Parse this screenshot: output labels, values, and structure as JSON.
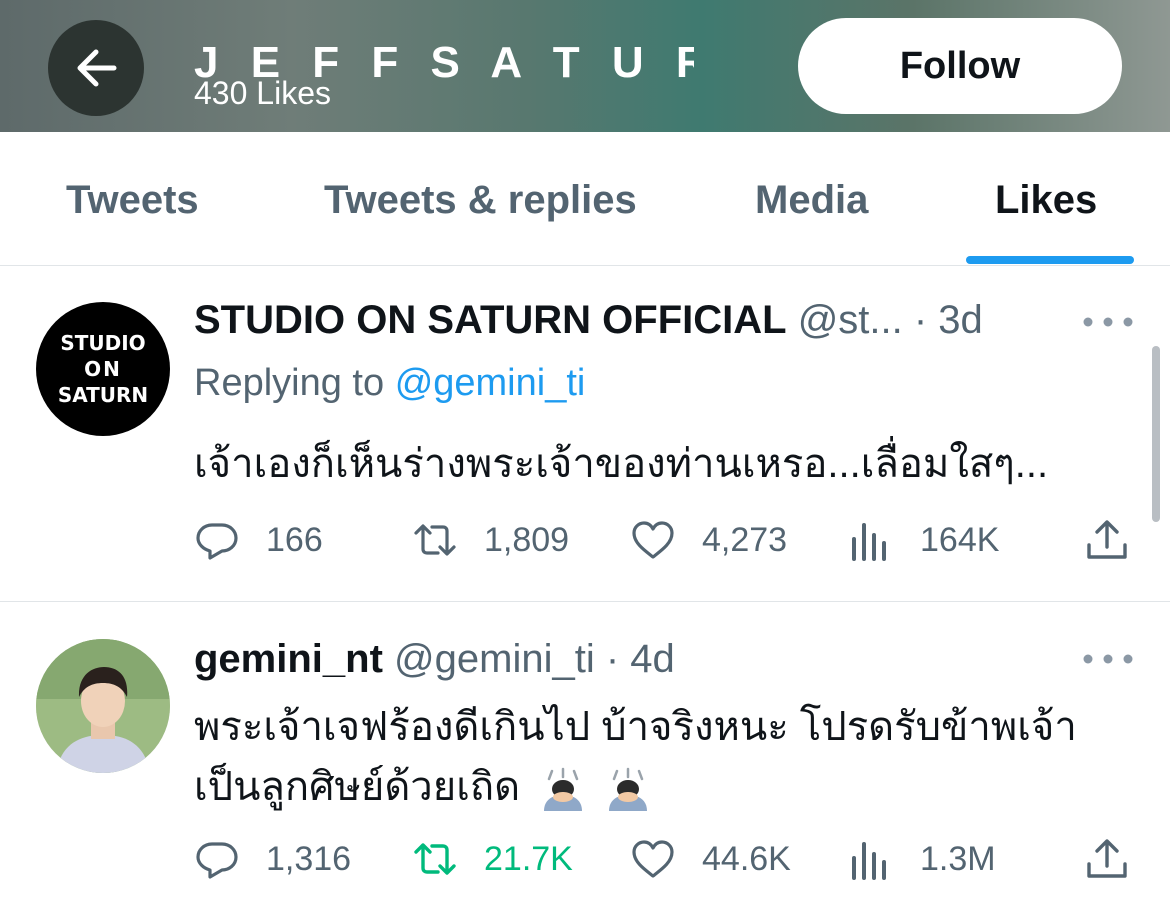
{
  "header": {
    "title": "J E F F S A T U R (罗...",
    "subtitle": "430 Likes",
    "follow_label": "Follow"
  },
  "tabs": [
    {
      "label": "Tweets",
      "active": false
    },
    {
      "label": "Tweets & replies",
      "active": false
    },
    {
      "label": "Media",
      "active": false
    },
    {
      "label": "Likes",
      "active": true
    }
  ],
  "colors": {
    "accent": "#1d9bf0",
    "retweet_green": "#00ba7c",
    "muted": "#536471"
  },
  "tweets": [
    {
      "avatar_lines": [
        "STUDIO",
        "ON",
        "SATURN"
      ],
      "display_name": "STUDIO ON SATURN OFFICIAL",
      "handle": "@st...",
      "time": "· 3d",
      "reply_prefix": "Replying to",
      "reply_to": "@gemini_ti",
      "text_lines": [
        "เจ้าเองก็เห็นร่างพระเจ้าของท่านเหรอ...เลื่อมใสๆ..."
      ],
      "replies": "166",
      "retweets": "1,809",
      "likes": "4,273",
      "views": "164K",
      "retweeted": false
    },
    {
      "display_name": "gemini_nt",
      "handle": "@gemini_ti",
      "time": "· 4d",
      "text_lines": [
        "พระเจ้าเจฟร้องดีเกินไป บ้าจริงหนะ โปรดรับข้าพเจ้า",
        "เป็นลูกศิษย์ด้วยเถิด"
      ],
      "emoji": [
        "person-bowing-emoji",
        "person-bowing-emoji"
      ],
      "replies": "1,316",
      "retweets": "21.7K",
      "likes": "44.6K",
      "views": "1.3M",
      "retweeted": true
    }
  ]
}
